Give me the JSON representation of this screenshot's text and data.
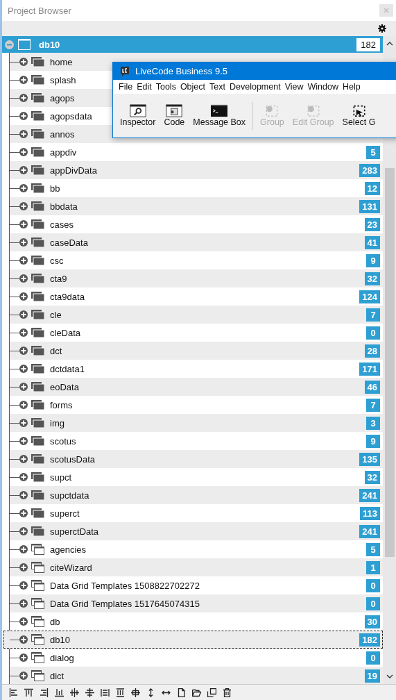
{
  "window": {
    "title": "Project Browser"
  },
  "root": {
    "label": "db10",
    "count": "182",
    "selected": true,
    "expanded": true
  },
  "rows": [
    {
      "label": "home",
      "kind": "card",
      "focused": false
    },
    {
      "label": "splash",
      "kind": "card",
      "focused": false
    },
    {
      "label": "agops",
      "kind": "card",
      "focused": false
    },
    {
      "label": "agopsdata",
      "kind": "card",
      "focused": false
    },
    {
      "label": "annos",
      "kind": "card",
      "focused": false
    },
    {
      "label": "appdiv",
      "kind": "card",
      "count": "5",
      "focused": false
    },
    {
      "label": "appDivData",
      "kind": "card",
      "count": "283",
      "focused": false
    },
    {
      "label": "bb",
      "kind": "card",
      "count": "12",
      "focused": false
    },
    {
      "label": "bbdata",
      "kind": "card",
      "count": "131",
      "focused": false
    },
    {
      "label": "cases",
      "kind": "card",
      "count": "23",
      "focused": false
    },
    {
      "label": "caseData",
      "kind": "card",
      "count": "41",
      "focused": false
    },
    {
      "label": "csc",
      "kind": "card",
      "count": "9",
      "focused": false
    },
    {
      "label": "cta9",
      "kind": "card",
      "count": "32",
      "focused": false
    },
    {
      "label": "cta9data",
      "kind": "card",
      "count": "124",
      "focused": false
    },
    {
      "label": "cle",
      "kind": "card",
      "count": "7",
      "focused": false
    },
    {
      "label": "cleData",
      "kind": "card",
      "count": "0",
      "focused": false
    },
    {
      "label": "dct",
      "kind": "card",
      "count": "28",
      "focused": false
    },
    {
      "label": "dctdata1",
      "kind": "card",
      "count": "171",
      "focused": false
    },
    {
      "label": "eoData",
      "kind": "card",
      "count": "46",
      "focused": false
    },
    {
      "label": "forms",
      "kind": "card",
      "count": "7",
      "focused": false
    },
    {
      "label": "img",
      "kind": "card",
      "count": "3",
      "focused": false
    },
    {
      "label": "scotus",
      "kind": "card",
      "count": "9",
      "focused": false
    },
    {
      "label": "scotusData",
      "kind": "card",
      "count": "135",
      "focused": false
    },
    {
      "label": "supct",
      "kind": "card",
      "count": "32",
      "focused": false
    },
    {
      "label": "supctdata",
      "kind": "card",
      "count": "241",
      "focused": false
    },
    {
      "label": "superct",
      "kind": "card",
      "count": "113",
      "focused": false
    },
    {
      "label": "superctData",
      "kind": "card",
      "count": "241",
      "focused": false
    },
    {
      "label": "agencies",
      "kind": "stack",
      "count": "5",
      "focused": false
    },
    {
      "label": "citeWizard",
      "kind": "stack",
      "count": "1",
      "focused": false
    },
    {
      "label": "Data Grid Templates 1508822702272",
      "kind": "stack",
      "count": "0",
      "focused": false
    },
    {
      "label": "Data Grid Templates 1517645074315",
      "kind": "stack",
      "count": "0",
      "focused": false
    },
    {
      "label": "db",
      "kind": "stack",
      "count": "30",
      "focused": false
    },
    {
      "label": "db10",
      "kind": "stack",
      "count": "182",
      "focused": true
    },
    {
      "label": "dialog",
      "kind": "stack",
      "count": "0",
      "focused": false
    },
    {
      "label": "dict",
      "kind": "stack",
      "count": "19",
      "focused": false
    }
  ],
  "floating_window": {
    "title": "LiveCode Business 9.5",
    "menu": [
      "File",
      "Edit",
      "Tools",
      "Object",
      "Text",
      "Development",
      "View",
      "Window",
      "Help"
    ],
    "tools": [
      {
        "label": "Inspector",
        "disabled": false
      },
      {
        "label": "Code",
        "disabled": false
      },
      {
        "label": "Message Box",
        "disabled": false
      },
      {
        "label": "Group",
        "disabled": true
      },
      {
        "label": "Edit Group",
        "disabled": true
      },
      {
        "label": "Select G",
        "disabled": false
      }
    ]
  }
}
